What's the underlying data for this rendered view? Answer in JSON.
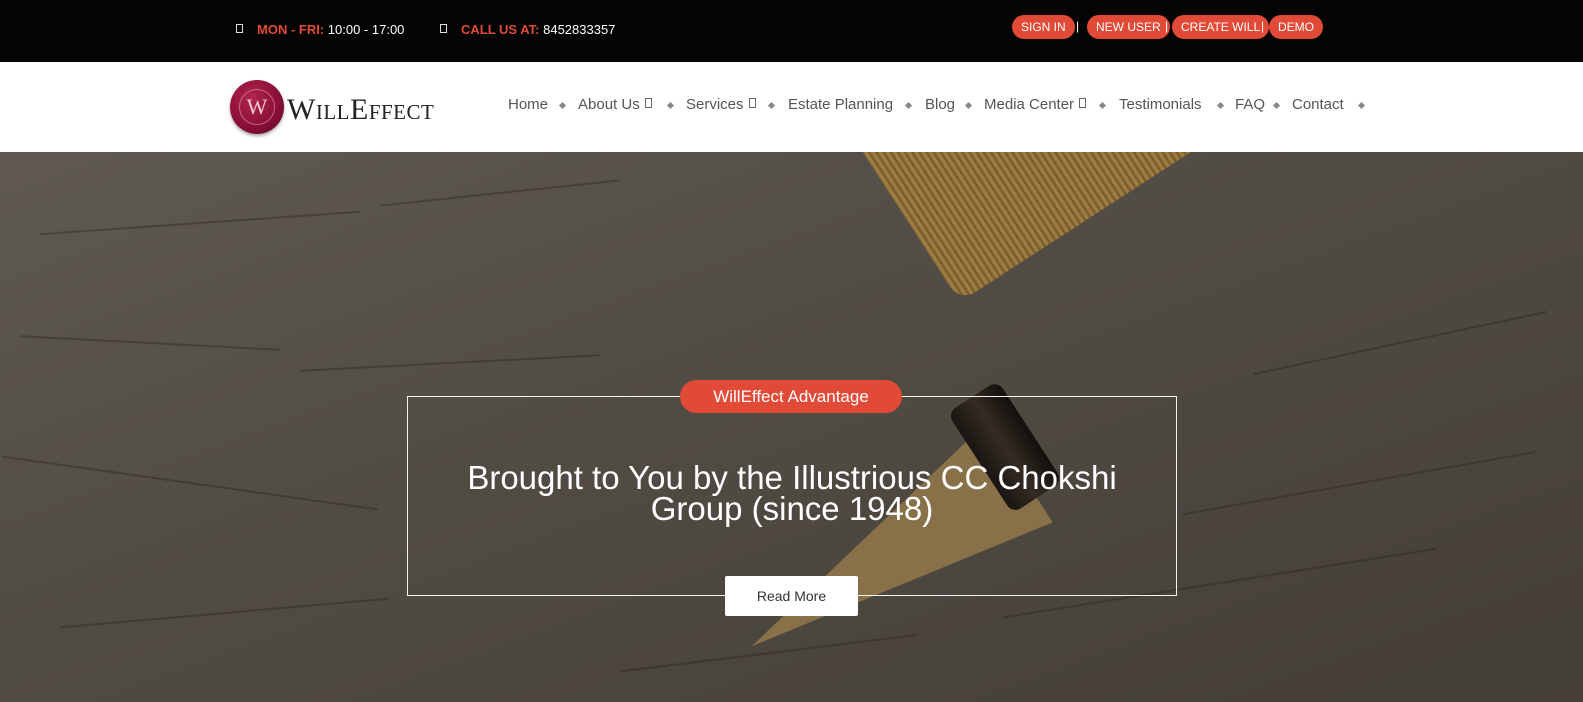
{
  "topbar": {
    "hours_label": "MON - FRI:",
    "hours_value": "10:00 - 17:00",
    "call_label": "CALL US AT:",
    "call_value": "8452833357",
    "account_links": [
      "SIGN IN",
      "NEW USER",
      "CREATE WILL",
      "DEMO"
    ],
    "separator": "|"
  },
  "brand": {
    "seal_letter": "W",
    "name_W": "W",
    "name_ill": "ILL",
    "name_E": "E",
    "name_ffect": "FFECT"
  },
  "nav": {
    "items": [
      "Home",
      "About Us",
      "Services",
      "Estate Planning",
      "Blog",
      "Media Center",
      "Testimonials",
      "FAQ",
      "Contact"
    ]
  },
  "hero": {
    "badge": "WillEffect Advantage",
    "headline": "Brought to You by the Illustrious CC Chokshi Group (since 1948)",
    "button": "Read More"
  },
  "colors": {
    "accent": "#e04a36",
    "topbar_bg": "#040404",
    "seal": "#8c1038"
  },
  "icons": {
    "hours": "clock-icon",
    "call": "phone-icon",
    "dropdown": "chevron-down-icon"
  }
}
